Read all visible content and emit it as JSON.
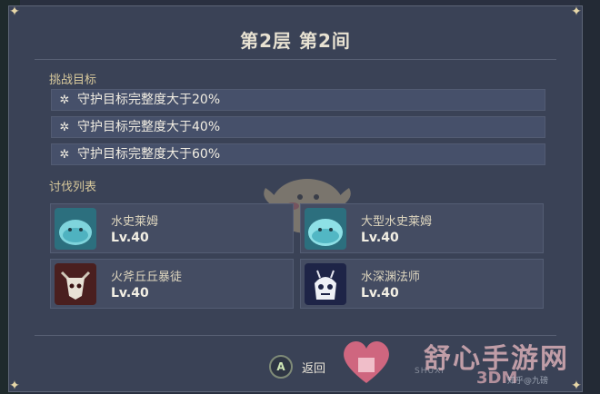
{
  "header": {
    "title": "第2层 第2间"
  },
  "objectives": {
    "section_label": "挑战目标",
    "items": [
      {
        "label": "守护目标完整度大于20%"
      },
      {
        "label": "守护目标完整度大于40%"
      },
      {
        "label": "守护目标完整度大于60%"
      }
    ]
  },
  "enemies": {
    "section_label": "讨伐列表",
    "items": [
      {
        "name": "水史莱姆",
        "level": "Lv.40",
        "icon": "hydro-slime-icon"
      },
      {
        "name": "大型水史莱姆",
        "level": "Lv.40",
        "icon": "large-hydro-slime-icon"
      },
      {
        "name": "火斧丘丘暴徒",
        "level": "Lv.40",
        "icon": "pyro-axe-mitachurl-icon"
      },
      {
        "name": "水深渊法师",
        "level": "Lv.40",
        "icon": "hydro-abyss-mage-icon"
      }
    ]
  },
  "footer": {
    "button_key": "A",
    "back_label": "返回"
  },
  "watermark": {
    "brand": "舒心手游网",
    "small": "SHUXI",
    "source": "3DM",
    "handle": "知乎@九磅"
  },
  "colors": {
    "panel": "#3a4256",
    "gold": "#d8c99c",
    "text": "#f1ede2",
    "card": "#444c62"
  }
}
